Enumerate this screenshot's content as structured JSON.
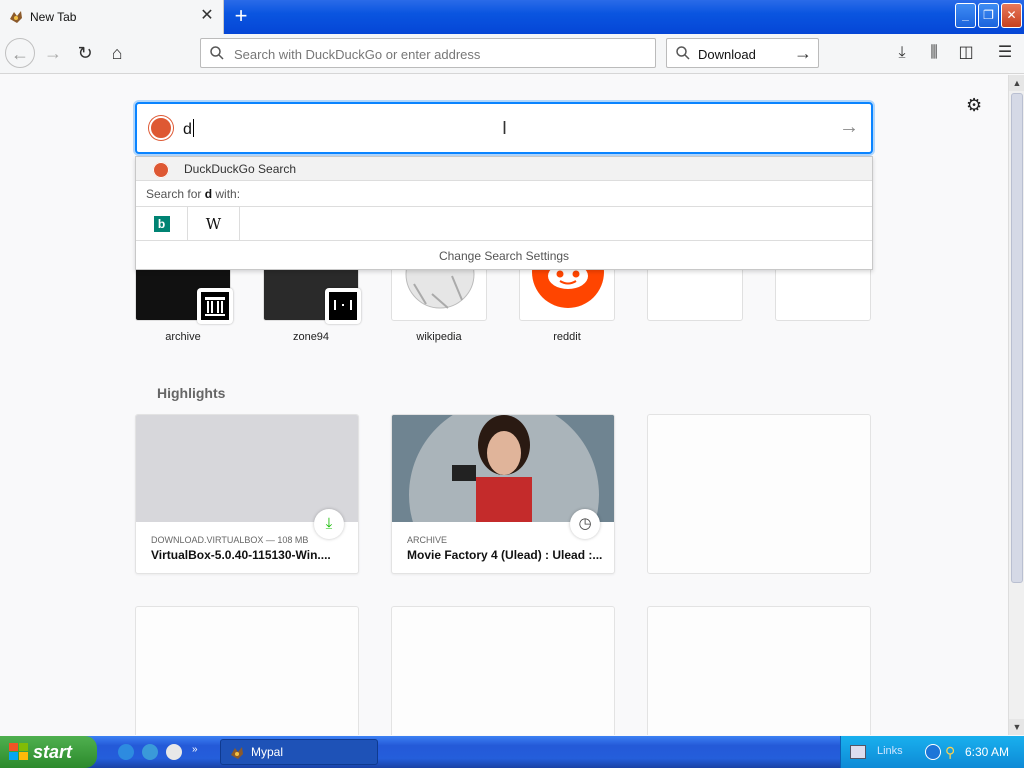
{
  "browser": {
    "tab_title": "New Tab",
    "urlbar_placeholder": "Search with DuckDuckGo or enter address",
    "searchbar_value": "Download"
  },
  "newtab": {
    "search_value": "d",
    "suggestions": {
      "engine_label": "DuckDuckGo Search",
      "search_for_prefix": "Search for ",
      "search_for_term": "d",
      "search_for_suffix": " with:",
      "change_settings": "Change Search Settings"
    },
    "topsites": [
      {
        "label": "archive"
      },
      {
        "label": "zone94"
      },
      {
        "label": "wikipedia"
      },
      {
        "label": "reddit"
      }
    ],
    "highlights": {
      "title": "Highlights",
      "cards": [
        {
          "context": "DOWNLOAD.VIRTUALBOX — 108 MB",
          "title": "VirtualBox-5.0.40-115130-Win...."
        },
        {
          "context": "ARCHIVE",
          "title": "Movie Factory 4 (Ulead) : Ulead :..."
        }
      ]
    }
  },
  "taskbar": {
    "start_label": "start",
    "task_label": "Mypal",
    "tray_links": "Links",
    "clock": "6:30 AM"
  },
  "colors": {
    "accent": "#0a84ff",
    "ddg": "#de5833",
    "reddit": "#ff4500",
    "bing": "#008373"
  }
}
